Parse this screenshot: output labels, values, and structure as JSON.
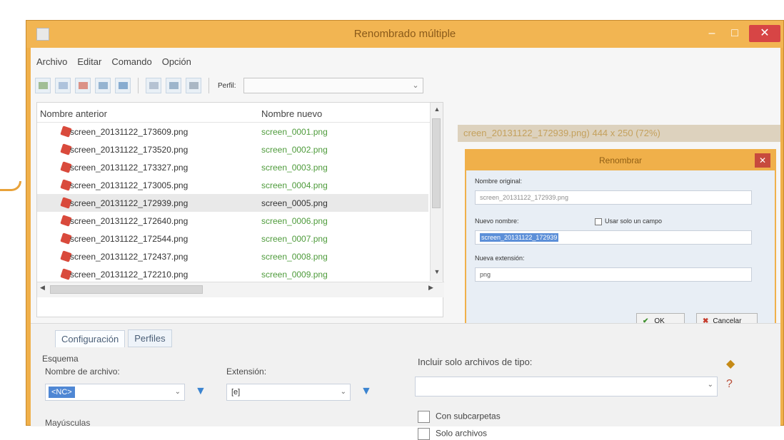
{
  "window": {
    "title": "Renombrado múltiple",
    "minimize": "–",
    "maximize": "□",
    "close": "✕"
  },
  "menu": [
    "Archivo",
    "Editar",
    "Comando",
    "Opción"
  ],
  "toolbar": {
    "perfil_label": "Perfil:",
    "perfil_value": ""
  },
  "list": {
    "headers": {
      "old": "Nombre anterior",
      "new": "Nombre nuevo"
    },
    "rows": [
      {
        "old": "screen_20131122_173609.png",
        "new": "screen_0001.png"
      },
      {
        "old": "screen_20131122_173520.png",
        "new": "screen_0002.png"
      },
      {
        "old": "screen_20131122_173327.png",
        "new": "screen_0003.png"
      },
      {
        "old": "screen_20131122_173005.png",
        "new": "screen_0004.png"
      },
      {
        "old": "screen_20131122_172939.png",
        "new": "screen_0005.png",
        "selected": true
      },
      {
        "old": "screen_20131122_172640.png",
        "new": "screen_0006.png"
      },
      {
        "old": "screen_20131122_172544.png",
        "new": "screen_0007.png"
      },
      {
        "old": "screen_20131122_172437.png",
        "new": "screen_0008.png"
      },
      {
        "old": "screen_20131122_172210.png",
        "new": "screen_0009.png"
      }
    ]
  },
  "preview": {
    "info": "creen_20131122_172939.png)  444 x 250 (72%)"
  },
  "dialog": {
    "title": "Renombrar",
    "close": "✕",
    "original_label": "Nombre original:",
    "original_value": "screen_20131122_172939.png",
    "new_label": "Nuevo nombre:",
    "single_field_label": "Usar solo un campo",
    "new_value": "screen_20131122_172939",
    "ext_label": "Nueva extensión:",
    "ext_value": "png",
    "ok": "OK",
    "cancel": "Cancelar"
  },
  "bottom": {
    "tabs": [
      "Configuración",
      "Perfiles"
    ],
    "scheme_label": "Esquema",
    "filename_label": "Nombre de archivo:",
    "filename_value": "<NC>",
    "extension_label": "Extensión:",
    "extension_value": "[e]",
    "include_label": "Incluir solo archivos de tipo:",
    "include_value": "",
    "subfolders_label": "Con subcarpetas",
    "cut_left": "Mayúsculas",
    "cut_right": "Solo archivos"
  },
  "colors": {
    "accent": "#f0b04a",
    "new_name_green": "#4e9b3b",
    "selection_blue": "#4f87d4"
  }
}
